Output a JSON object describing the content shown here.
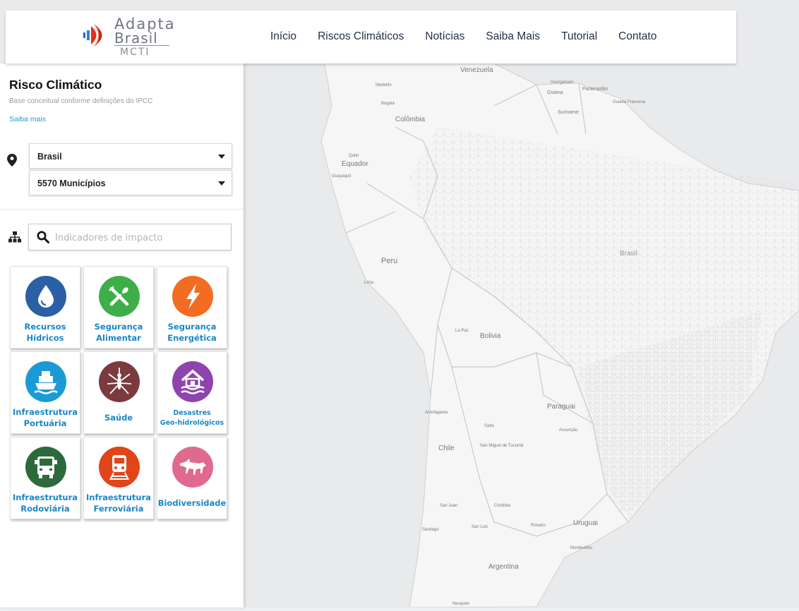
{
  "brand": {
    "line1": "Adapta",
    "line2": "Brasil",
    "line3": "MCTI"
  },
  "nav": [
    "Início",
    "Riscos Climáticos",
    "Notícias",
    "Saiba Mais",
    "Tutorial",
    "Contato"
  ],
  "sidebar": {
    "title": "Risco Climático",
    "subtitle": "Base conceitual conforme definições do IPCC",
    "more_link": "Saiba mais",
    "region_select": "Brasil",
    "units_select": "5570 Municípios",
    "search_placeholder": "Indicadores de impacto"
  },
  "sectors": [
    {
      "line1": "Recursos",
      "line2": "Hídricos",
      "icon": "water-drop-icon",
      "color": "#2b5fa6"
    },
    {
      "line1": "Segurança",
      "line2": "Alimentar",
      "icon": "fork-knife-icon",
      "color": "#3fae49"
    },
    {
      "line1": "Segurança",
      "line2": "Energética",
      "icon": "lightning-icon",
      "color": "#f26c21"
    },
    {
      "line1": "Infraestrutura",
      "line2": "Portuária",
      "icon": "ship-icon",
      "color": "#1c9ad6"
    },
    {
      "line1": "Saúde",
      "line2": "",
      "icon": "mosquito-icon",
      "color": "#7b3b3e"
    },
    {
      "line1": "Desastres",
      "line2": "Geo-hidrológicos",
      "icon": "flooded-house-icon",
      "color": "#8e44ad"
    },
    {
      "line1": "Infraestrutura",
      "line2": "Rodoviária",
      "icon": "truck-icon",
      "color": "#2c6a3c"
    },
    {
      "line1": "Infraestrutura",
      "line2": "Ferroviária",
      "icon": "train-icon",
      "color": "#e0461a"
    },
    {
      "line1": "Biodiversidade",
      "line2": "",
      "icon": "wolf-icon",
      "color": "#e0698e"
    }
  ],
  "map_labels": {
    "venezuela": "Venezuela",
    "georgetown": "Georgetown",
    "guiana": "Guiana",
    "paramaribo": "Paramaribo",
    "guiana_francesa": "Guiana Francesa",
    "suriname": "Suriname",
    "medellin": "Medellín",
    "bogota": "Bogotá",
    "colombia": "Colômbia",
    "quito": "Quito",
    "equador": "Equador",
    "guayaquil": "Guayaquil",
    "peru": "Peru",
    "lima": "Lima",
    "brasil": "Brasil",
    "la_paz": "La Paz",
    "bolivia": "Bolivia",
    "paraguai": "Paraguai",
    "assuncao": "Assunção",
    "antofagasta": "Antofagasta",
    "salta": "Salta",
    "chile": "Chile",
    "tucuma": "San Miguel de Tucumá",
    "cordoba": "Córdoba",
    "san_juan": "San Juan",
    "santiago": "Santiago",
    "san_luis": "San Luis",
    "rosario": "Rosario",
    "uruguai": "Uruguai",
    "montevideu": "Montevidéu",
    "argentina": "Argentina",
    "neuquen": "Neuquén"
  },
  "colors": {
    "link": "#1a9ad6",
    "tile_label": "#1a87c6",
    "nav_text": "#1f2f4a",
    "ocean": "#e9eaec",
    "land": "#f6f6f6"
  }
}
